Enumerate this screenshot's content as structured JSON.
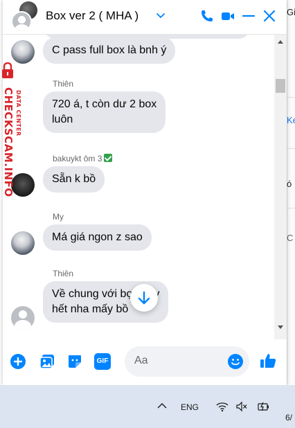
{
  "chat": {
    "title": "Box ver 2 ( MHA )",
    "accent_color": "#0084ff"
  },
  "messages": [
    {
      "text": "C pass full box là bnh ý"
    },
    {
      "sender": "Thiên",
      "text_lines": [
        "720 á, t còn dư 2 box",
        "luôn"
      ]
    },
    {
      "sender": "bakuykt ôm 3",
      "text": "Sẵn k bồ"
    },
    {
      "sender": "My",
      "text": "Má giá ngon z sao"
    },
    {
      "sender": "Thiên",
      "text_lines": [
        "Về chung với bọn này",
        "hết nha mấy bồ"
      ]
    }
  ],
  "composer": {
    "placeholder": "Aa",
    "gif_label": "GIF"
  },
  "background_window": {
    "fragments": [
      "Gi",
      "Ke",
      "ó",
      "C"
    ]
  },
  "watermark": {
    "brand": "CHECKSCAM.INFO",
    "sub": "DATA CENTER"
  },
  "taskbar": {
    "language": "ENG",
    "date_fragment": "6/"
  }
}
